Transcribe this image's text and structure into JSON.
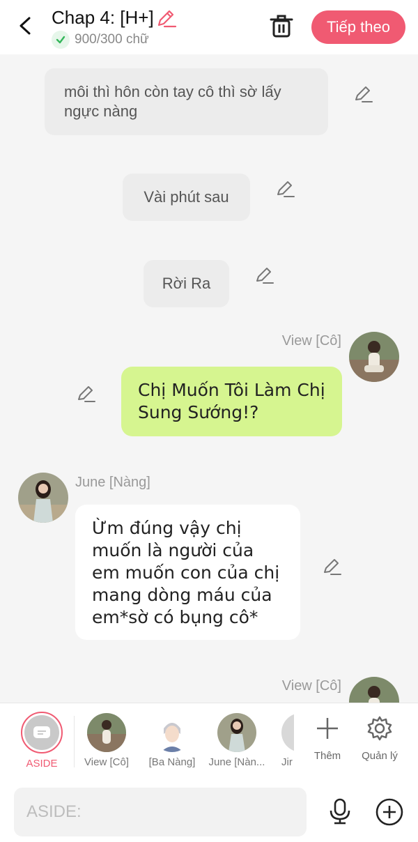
{
  "header": {
    "title": "Chap 4: [H+]",
    "word_count": "900/300 chữ",
    "next_label": "Tiếp theo",
    "accent_color": "#f05a72"
  },
  "messages": {
    "narration_1": "môi thì hôn còn tay cô thì sờ lấy ngực nàng",
    "narration_2": "Vài phút sau",
    "narration_3": "Rời Ra",
    "msg_view_1": {
      "name": "View [Cô]",
      "text": "Chị Muốn Tôi Làm Chị Sung Sướng!?",
      "bubble_color": "#d6f590"
    },
    "msg_june": {
      "name": "June [Nàng]",
      "text": "Ừm đúng vậy chị muốn là người của em muốn con của chị mang dòng máu của em*sờ có bụng cô*"
    },
    "msg_view_2": {
      "name": "View [Cô]"
    }
  },
  "characters": {
    "aside": "ASIDE",
    "c1": "View [Cô]",
    "c2": "[Ba Nàng]",
    "c3": "June [Nàn...",
    "c4": "Jir"
  },
  "tools": {
    "more": "Thêm",
    "manage": "Quản lý"
  },
  "composer": {
    "placeholder": "ASIDE:"
  }
}
